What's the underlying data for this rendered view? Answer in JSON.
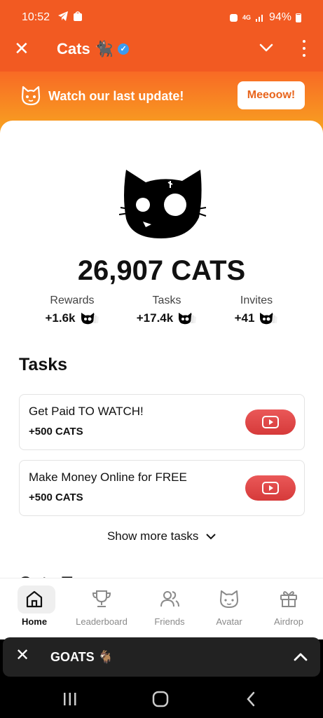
{
  "status_bar": {
    "time": "10:52",
    "network": "4G",
    "battery": "94%",
    "left_icons": [
      "telegram-icon",
      "shop-icon"
    ],
    "right_icons": [
      "alarm-icon",
      "network-4g-icon",
      "signal-icon",
      "battery-icon"
    ]
  },
  "header": {
    "title": "Cats",
    "title_emoji": "🐈‍⬛",
    "verified": "✓"
  },
  "banner": {
    "text": "Watch our last update!",
    "button": "Meeoow!"
  },
  "balance": {
    "amount": "26,907 CATS"
  },
  "stats": [
    {
      "label": "Rewards",
      "value": "+1.6k"
    },
    {
      "label": "Tasks",
      "value": "+17.4k"
    },
    {
      "label": "Invites",
      "value": "+41"
    }
  ],
  "tasks": {
    "title": "Tasks",
    "items": [
      {
        "title": "Get Paid TO WATCH!",
        "reward": "+500 CATS"
      },
      {
        "title": "Make Money Online for FREE",
        "reward": "+500 CATS"
      }
    ],
    "show_more": "Show more tasks",
    "next_section_peek": "Cats T"
  },
  "nav": {
    "items": [
      {
        "label": "Home",
        "icon": "home-icon",
        "active": true
      },
      {
        "label": "Leaderboard",
        "icon": "trophy-icon",
        "active": false
      },
      {
        "label": "Friends",
        "icon": "friends-icon",
        "active": false
      },
      {
        "label": "Avatar",
        "icon": "cat-face-icon",
        "active": false
      },
      {
        "label": "Airdrop",
        "icon": "gift-icon",
        "active": false
      }
    ]
  },
  "mini_app": {
    "title": "GOATS 🐐"
  },
  "colors": {
    "accent": "#f25a22",
    "banner_start": "#f86a25",
    "banner_end": "#f8a520",
    "button_text": "#e8651d",
    "youtube_red": "#e04848"
  }
}
